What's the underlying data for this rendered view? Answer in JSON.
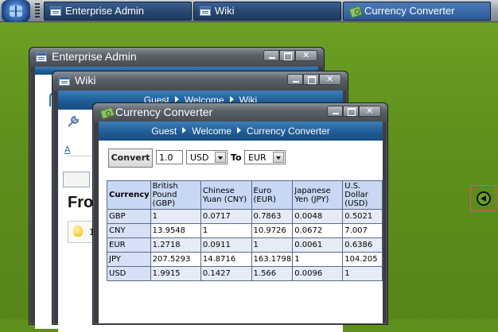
{
  "taskbar": {
    "tabs": [
      {
        "label": "Enterprise Admin",
        "icon": "window-icon"
      },
      {
        "label": "Wiki",
        "icon": "window-icon"
      },
      {
        "label": "Currency Converter",
        "icon": "money-icon",
        "active": true
      }
    ]
  },
  "windows": {
    "enterprise_admin": {
      "title": "Enterprise Admin"
    },
    "wiki": {
      "title": "Wiki",
      "breadcrumb": [
        "Guest",
        "Welcome",
        "Wiki"
      ],
      "partial_heading": "Fro",
      "partial_link": "A",
      "partial_text": "1"
    },
    "currency_converter": {
      "title": "Currency Converter",
      "breadcrumb": [
        "Guest",
        "Welcome",
        "Currency Converter"
      ],
      "convert_label": "Convert",
      "amount": "1.0",
      "from_currency": "USD",
      "to_label": "To",
      "to_currency": "EUR",
      "table": {
        "header": [
          "Currency",
          "British Pound (GBP)",
          "Chinese Yuan (CNY)",
          "Euro (EUR)",
          "Japanese Yen (JPY)",
          "U.S. Dollar (USD)"
        ],
        "rows": [
          [
            "GBP",
            "1",
            "0.0717",
            "0.7863",
            "0.0048",
            "0.5021"
          ],
          [
            "CNY",
            "13.9548",
            "1",
            "10.9726",
            "0.0672",
            "7.007"
          ],
          [
            "EUR",
            "1.2718",
            "0.0911",
            "1",
            "0.0061",
            "0.6386"
          ],
          [
            "JPY",
            "207.5293",
            "14.8716",
            "163.1798",
            "1",
            "104.205"
          ],
          [
            "USD",
            "1.9915",
            "0.1427",
            "1.566",
            "0.0096",
            "1"
          ]
        ]
      }
    }
  },
  "colors": {
    "desktop": "#6ea224",
    "breadcrumb": "#1f5c97",
    "table_header": "#c8d7f3"
  }
}
